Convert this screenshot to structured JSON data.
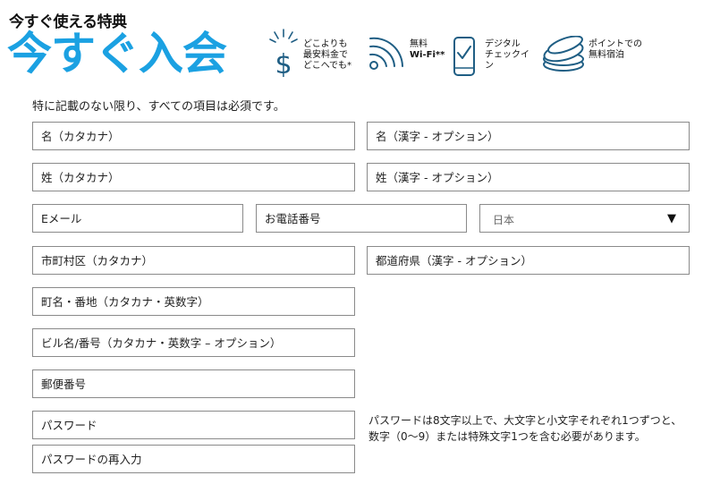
{
  "header": {
    "subtitle": "今すぐ使える特典",
    "title": "今すぐ入会"
  },
  "benefits": [
    {
      "icon": "dollar-sparkle-icon",
      "lines": [
        "どこよりも",
        "最安料金で",
        "どこへでも*"
      ]
    },
    {
      "icon": "wifi-icon",
      "lines": [
        "無料",
        "Wi-Fi**"
      ]
    },
    {
      "icon": "mobile-checkin-icon",
      "lines": [
        "デジタル",
        "チェックイ",
        "ン"
      ]
    },
    {
      "icon": "coins-icon",
      "lines": [
        "ポイントでの",
        "無料宿泊"
      ]
    }
  ],
  "form": {
    "required_note": "特に記載のない限り、すべての項目は必須です。",
    "fields": {
      "first_name_kana": "名（カタカナ）",
      "first_name_kanji": "名（漢字 - オプション）",
      "last_name_kana": "姓（カタカナ）",
      "last_name_kanji": "姓（漢字 - オプション）",
      "email": "Eメール",
      "phone": "お電話番号",
      "country": "日本",
      "city_kana": "市町村区（カタカナ）",
      "prefecture_kanji": "都道府県（漢字 - オプション）",
      "street_kana": "町名・番地（カタカナ・英数字）",
      "building_kana": "ビル名/番号（カタカナ・英数字 – オプション）",
      "postal_code": "郵便番号",
      "password": "パスワード",
      "password_confirm": "パスワードの再入力"
    },
    "password_hint": "パスワードは8文字以上で、大文字と小文字それぞれ1つずつと、数字（0～9）または特殊文字1つを含む必要があります。"
  },
  "colors": {
    "brand_blue": "#1ba1e2",
    "icon_navy": "#1f5e84",
    "field_border": "#8a8a8a"
  }
}
